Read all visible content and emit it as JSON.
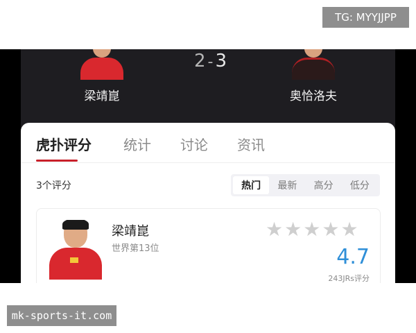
{
  "watermarks": {
    "top_right": "TG: MYYJJPP",
    "bottom_left": "mk-sports-it.com"
  },
  "match": {
    "home_player": "梁靖崑",
    "away_player": "奥恰洛夫",
    "home_score": "2",
    "separator": "-",
    "away_score": "3"
  },
  "tabs": [
    {
      "label": "虎扑评分",
      "active": true
    },
    {
      "label": "统计",
      "active": false
    },
    {
      "label": "讨论",
      "active": false
    },
    {
      "label": "资讯",
      "active": false
    }
  ],
  "ratings": {
    "count_label": "3个评分",
    "sort_options": [
      {
        "label": "热门",
        "active": true
      },
      {
        "label": "最新",
        "active": false
      },
      {
        "label": "高分",
        "active": false
      },
      {
        "label": "低分",
        "active": false
      }
    ],
    "items": [
      {
        "name": "梁靖崑",
        "rank": "世界第13位",
        "score": "4.7",
        "votes": "243JRs评分",
        "stars_filled": 0,
        "stars_total": 5
      }
    ]
  },
  "colors": {
    "accent_red": "#c8202a",
    "score_blue": "#2f8fd8",
    "dark_header": "#1e1d21"
  },
  "icons": {
    "star": "star-icon"
  }
}
